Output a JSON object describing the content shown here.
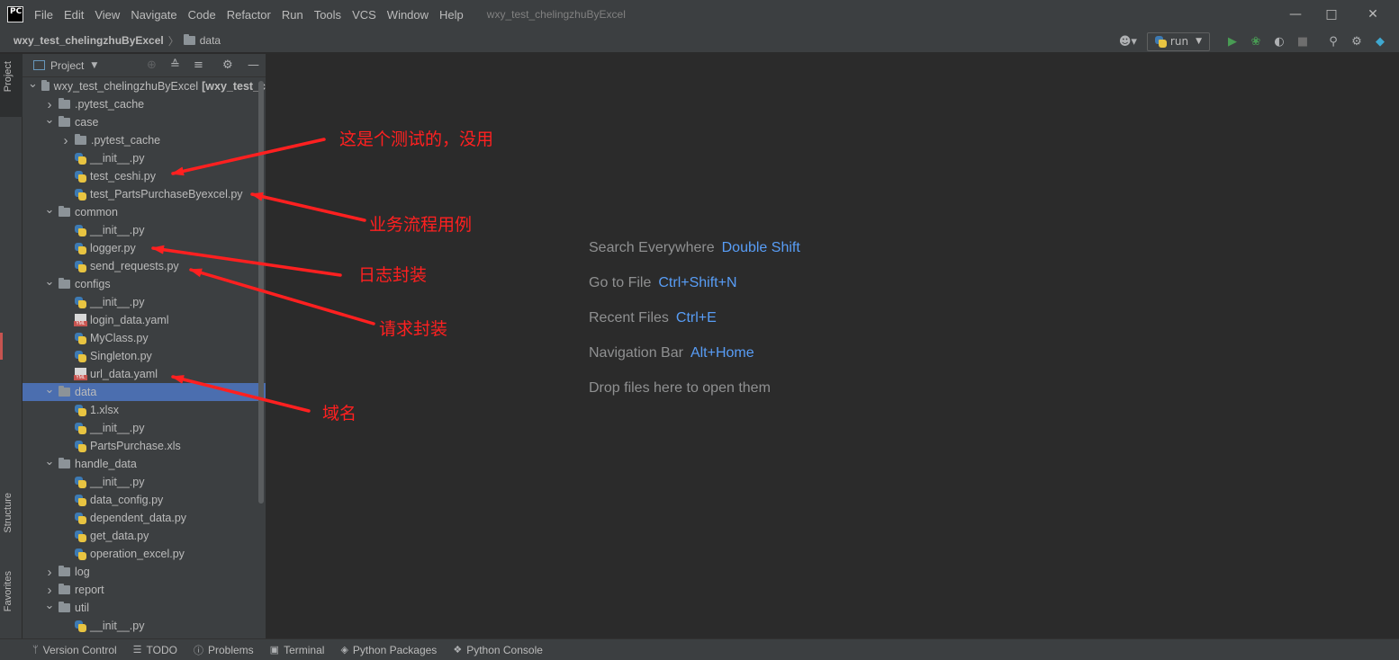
{
  "app": {
    "logo_text": "PC",
    "window_title": "wxy_test_chelingzhuByExcel"
  },
  "menu": [
    "File",
    "Edit",
    "View",
    "Navigate",
    "Code",
    "Refactor",
    "Run",
    "Tools",
    "VCS",
    "Window",
    "Help"
  ],
  "navbar": {
    "project": "wxy_test_chelingzhuByExcel",
    "separator": "〉",
    "current": "data",
    "run_config": "run"
  },
  "left_strip": {
    "project_tab": "Project",
    "structure_tab": "Structure",
    "favorites_tab": "Favorites"
  },
  "project_panel": {
    "title": "Project",
    "tree": [
      {
        "depth": 0,
        "chevron": "open",
        "icon": "folder",
        "label": "wxy_test_chelingzhuByExcel",
        "suffix": "[wxy_test_c"
      },
      {
        "depth": 1,
        "chevron": "closed",
        "icon": "folder",
        "label": ".pytest_cache"
      },
      {
        "depth": 1,
        "chevron": "open",
        "icon": "folder",
        "label": "case"
      },
      {
        "depth": 2,
        "chevron": "closed",
        "icon": "folder",
        "label": ".pytest_cache"
      },
      {
        "depth": 2,
        "chevron": "none",
        "icon": "python",
        "label": "__init__.py"
      },
      {
        "depth": 2,
        "chevron": "none",
        "icon": "python",
        "label": "test_ceshi.py"
      },
      {
        "depth": 2,
        "chevron": "none",
        "icon": "python",
        "label": "test_PartsPurchaseByexcel.py"
      },
      {
        "depth": 1,
        "chevron": "open",
        "icon": "folder",
        "label": "common"
      },
      {
        "depth": 2,
        "chevron": "none",
        "icon": "python",
        "label": "__init__.py"
      },
      {
        "depth": 2,
        "chevron": "none",
        "icon": "python",
        "label": "logger.py"
      },
      {
        "depth": 2,
        "chevron": "none",
        "icon": "python",
        "label": "send_requests.py"
      },
      {
        "depth": 1,
        "chevron": "open",
        "icon": "folder",
        "label": "configs"
      },
      {
        "depth": 2,
        "chevron": "none",
        "icon": "python",
        "label": "__init__.py"
      },
      {
        "depth": 2,
        "chevron": "none",
        "icon": "yaml",
        "label": "login_data.yaml"
      },
      {
        "depth": 2,
        "chevron": "none",
        "icon": "python",
        "label": "MyClass.py"
      },
      {
        "depth": 2,
        "chevron": "none",
        "icon": "python",
        "label": "Singleton.py"
      },
      {
        "depth": 2,
        "chevron": "none",
        "icon": "yaml",
        "label": "url_data.yaml"
      },
      {
        "depth": 1,
        "chevron": "open",
        "icon": "folder",
        "label": "data",
        "selected": true
      },
      {
        "depth": 2,
        "chevron": "none",
        "icon": "python",
        "label": "1.xlsx"
      },
      {
        "depth": 2,
        "chevron": "none",
        "icon": "python",
        "label": "__init__.py"
      },
      {
        "depth": 2,
        "chevron": "none",
        "icon": "python",
        "label": "PartsPurchase.xls"
      },
      {
        "depth": 1,
        "chevron": "open",
        "icon": "folder",
        "label": "handle_data"
      },
      {
        "depth": 2,
        "chevron": "none",
        "icon": "python",
        "label": "__init__.py"
      },
      {
        "depth": 2,
        "chevron": "none",
        "icon": "python",
        "label": "data_config.py"
      },
      {
        "depth": 2,
        "chevron": "none",
        "icon": "python",
        "label": "dependent_data.py"
      },
      {
        "depth": 2,
        "chevron": "none",
        "icon": "python",
        "label": "get_data.py"
      },
      {
        "depth": 2,
        "chevron": "none",
        "icon": "python",
        "label": "operation_excel.py"
      },
      {
        "depth": 1,
        "chevron": "closed",
        "icon": "folder",
        "label": "log"
      },
      {
        "depth": 1,
        "chevron": "closed",
        "icon": "folder",
        "label": "report"
      },
      {
        "depth": 1,
        "chevron": "open",
        "icon": "folder",
        "label": "util"
      },
      {
        "depth": 2,
        "chevron": "none",
        "icon": "python",
        "label": "__init__.py"
      }
    ]
  },
  "editor": {
    "hints": [
      {
        "label": "Search Everywhere",
        "shortcut": "Double Shift"
      },
      {
        "label": "Go to File",
        "shortcut": "Ctrl+Shift+N"
      },
      {
        "label": "Recent Files",
        "shortcut": "Ctrl+E"
      },
      {
        "label": "Navigation Bar",
        "shortcut": "Alt+Home"
      },
      {
        "label": "Drop files here to open them",
        "shortcut": ""
      }
    ]
  },
  "bottom_tabs": [
    {
      "icon": "branch-icon",
      "label": "Version Control"
    },
    {
      "icon": "list-icon",
      "label": "TODO"
    },
    {
      "icon": "info-icon",
      "label": "Problems"
    },
    {
      "icon": "terminal-icon",
      "label": "Terminal"
    },
    {
      "icon": "package-icon",
      "label": "Python Packages"
    },
    {
      "icon": "console-icon",
      "label": "Python Console"
    }
  ],
  "annotations": {
    "color": "#ff2020",
    "notes": [
      "这是个测试的，没用",
      "业务流程用例",
      "日志封装",
      "请求封装",
      "域名"
    ]
  }
}
